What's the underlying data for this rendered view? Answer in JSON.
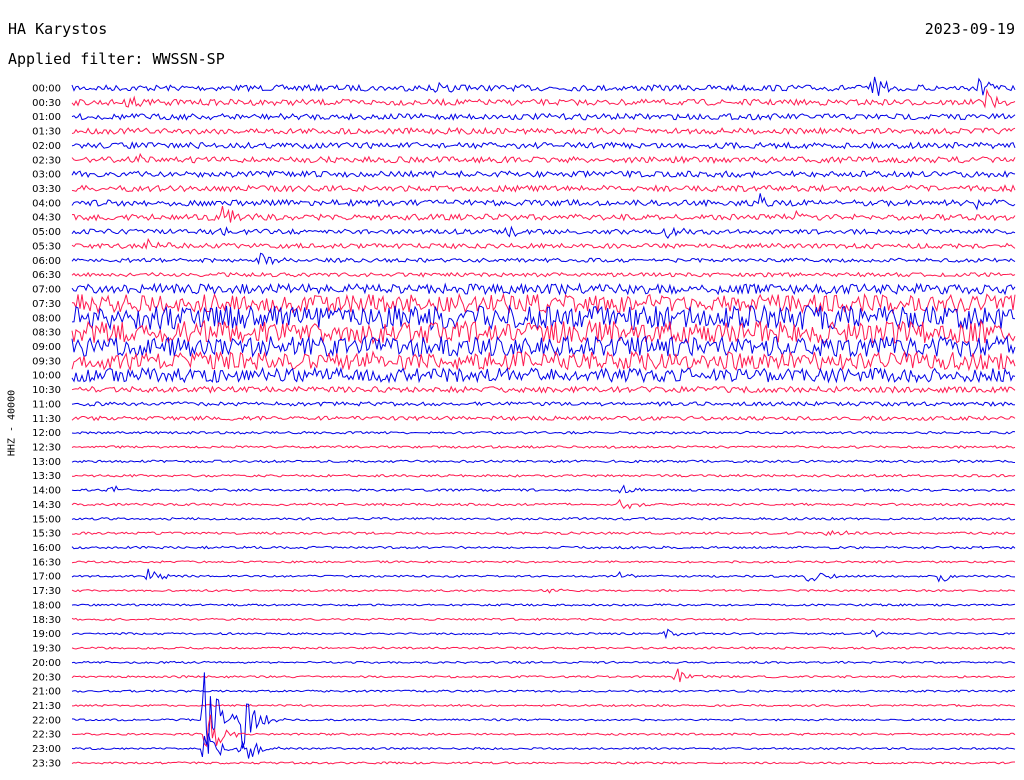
{
  "header": {
    "station": "HA Karystos",
    "date": "2023-09-19",
    "filter": "Applied filter: WWSSN-SP"
  },
  "channel_label": "HHZ - 40000",
  "colors": {
    "even_row": "#0000e6",
    "odd_row": "#ff1a50"
  },
  "chart_data": {
    "type": "line",
    "title": "HA Karystos",
    "subtitle": "Applied filter: WWSSN-SP",
    "ylabel": "HHZ - 40000",
    "xlabel": "",
    "row_labels": [
      "00:00",
      "00:30",
      "01:00",
      "01:30",
      "02:00",
      "02:30",
      "03:00",
      "03:30",
      "04:00",
      "04:30",
      "05:00",
      "05:30",
      "06:00",
      "06:30",
      "07:00",
      "07:30",
      "08:00",
      "08:30",
      "09:00",
      "09:30",
      "10:00",
      "10:30",
      "11:00",
      "11:30",
      "12:00",
      "12:30",
      "13:00",
      "13:30",
      "14:00",
      "14:30",
      "15:00",
      "15:30",
      "16:00",
      "16:30",
      "17:00",
      "17:30",
      "18:00",
      "18:30",
      "19:00",
      "19:30",
      "20:00",
      "20:30",
      "21:00",
      "21:30",
      "22:00",
      "22:30",
      "23:00",
      "23:30"
    ],
    "row_minutes": 30,
    "noise_level": [
      3,
      3,
      3,
      3,
      3,
      3,
      3,
      3,
      3,
      3,
      2.5,
      2.5,
      2,
      2,
      5,
      9,
      12,
      11,
      10,
      9,
      7,
      3,
      2,
      2,
      1.2,
      1.2,
      1.2,
      1.2,
      1.2,
      1.2,
      1.2,
      1.2,
      1.2,
      1,
      1,
      1,
      1,
      1,
      1,
      1,
      1,
      1,
      1,
      1,
      1,
      1,
      1,
      1
    ],
    "events": [
      {
        "row": 0,
        "t": 0.38,
        "amp": 12
      },
      {
        "row": 0,
        "t": 0.85,
        "amp": 16
      },
      {
        "row": 0,
        "t": 0.96,
        "amp": 14
      },
      {
        "row": 1,
        "t": 0.06,
        "amp": 8
      },
      {
        "row": 1,
        "t": 0.97,
        "amp": 14
      },
      {
        "row": 5,
        "t": 0.06,
        "amp": 9
      },
      {
        "row": 8,
        "t": 0.73,
        "amp": 10
      },
      {
        "row": 8,
        "t": 0.96,
        "amp": 8
      },
      {
        "row": 9,
        "t": 0.16,
        "amp": 10
      },
      {
        "row": 9,
        "t": 0.77,
        "amp": 10
      },
      {
        "row": 10,
        "t": 0.15,
        "amp": 9
      },
      {
        "row": 10,
        "t": 0.46,
        "amp": 8
      },
      {
        "row": 10,
        "t": 0.63,
        "amp": 9
      },
      {
        "row": 11,
        "t": 0.08,
        "amp": 8
      },
      {
        "row": 12,
        "t": 0.2,
        "amp": 12
      },
      {
        "row": 28,
        "t": 0.04,
        "amp": 6
      },
      {
        "row": 28,
        "t": 0.58,
        "amp": 6
      },
      {
        "row": 29,
        "t": 0.58,
        "amp": 8
      },
      {
        "row": 31,
        "t": 0.8,
        "amp": 6
      },
      {
        "row": 34,
        "t": 0.08,
        "amp": 8
      },
      {
        "row": 34,
        "t": 0.58,
        "amp": 6
      },
      {
        "row": 34,
        "t": 0.78,
        "amp": 10
      },
      {
        "row": 34,
        "t": 0.92,
        "amp": 8
      },
      {
        "row": 35,
        "t": 0.5,
        "amp": 4
      },
      {
        "row": 38,
        "t": 0.63,
        "amp": 5
      },
      {
        "row": 38,
        "t": 0.85,
        "amp": 5
      },
      {
        "row": 41,
        "t": 0.64,
        "amp": 10
      },
      {
        "row": 44,
        "t": 0.14,
        "amp": 80
      },
      {
        "row": 44,
        "t": 0.18,
        "amp": 40
      },
      {
        "row": 45,
        "t": 0.14,
        "amp": 35
      },
      {
        "row": 46,
        "t": 0.14,
        "amp": 25
      },
      {
        "row": 46,
        "t": 0.18,
        "amp": 20
      }
    ]
  }
}
